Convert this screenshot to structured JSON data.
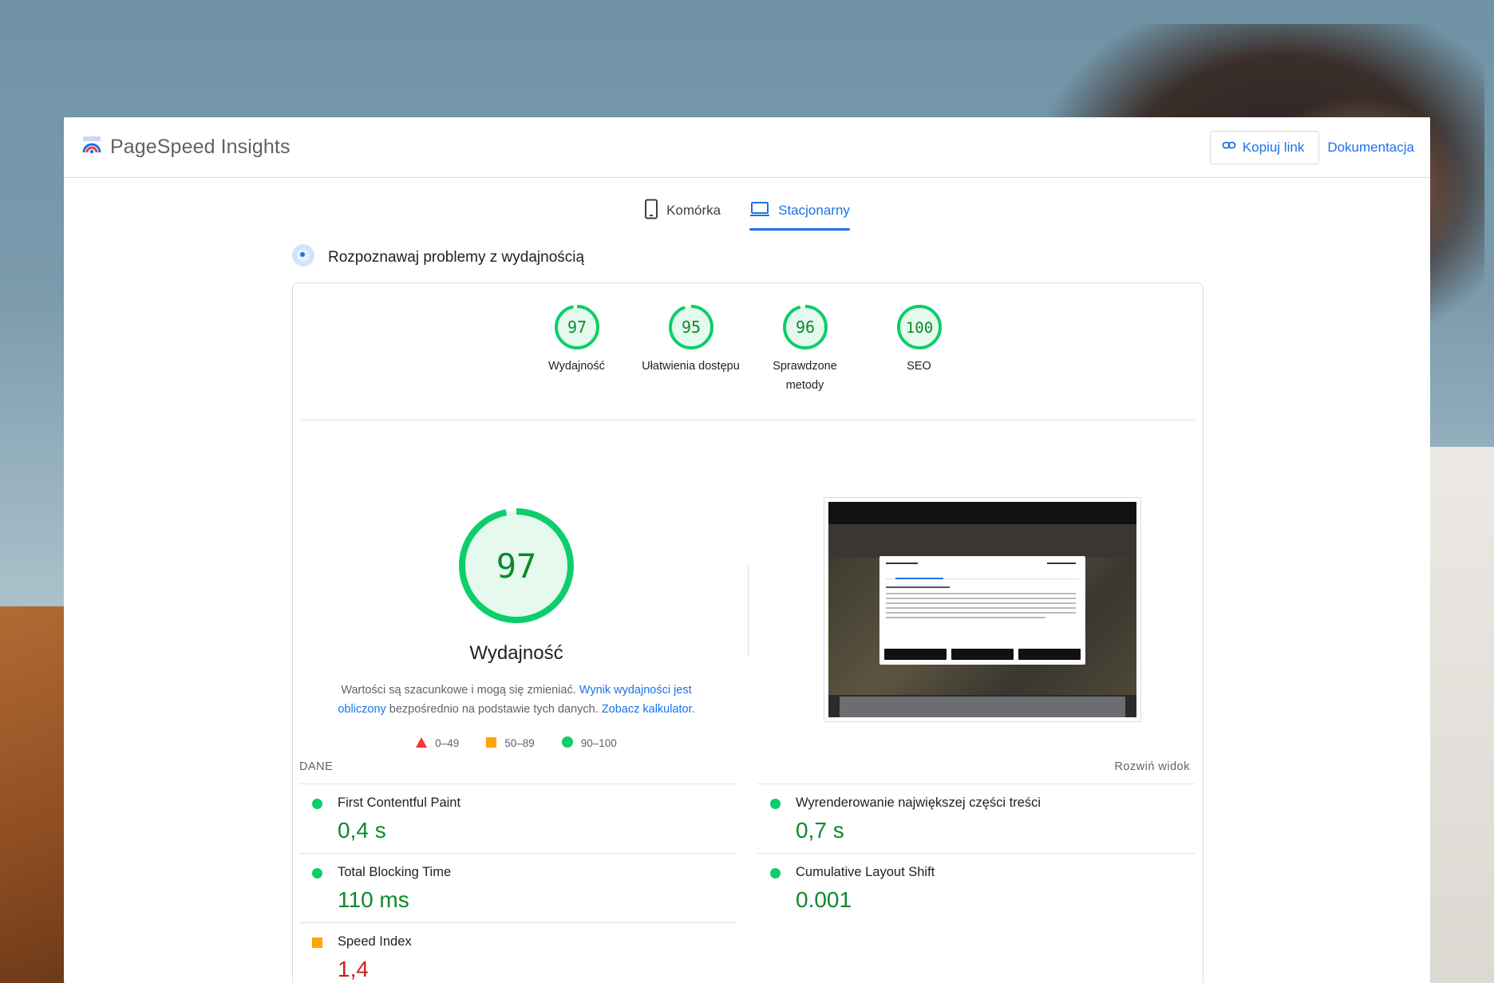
{
  "app": {
    "title": "PageSpeed Insights",
    "copy_link": "Kopiuj link",
    "docs": "Dokumentacja"
  },
  "tabs": [
    {
      "label": "Komórka",
      "active": false
    },
    {
      "label": "Stacjonarny",
      "active": true
    }
  ],
  "diagnose": {
    "label": "Rozpoznawaj problemy z wydajnością"
  },
  "categories": [
    {
      "score": "97",
      "label": "Wydajność",
      "value": 97
    },
    {
      "score": "95",
      "label": "Ułatwienia dostępu",
      "value": 95
    },
    {
      "score": "96",
      "label": "Sprawdzone metody",
      "value": 96
    },
    {
      "score": "100",
      "label": "SEO",
      "value": 100
    }
  ],
  "performance": {
    "score": "97",
    "value": 97,
    "title": "Wydajność",
    "desc_1": "Wartości są szacunkowe i mogą się zmieniać.",
    "desc_link_1": "Wynik wydajności jest obliczony",
    "desc_2": "bezpośrednio na podstawie tych danych.",
    "desc_link_2": "Zobacz kalkulator",
    "desc_3": "."
  },
  "legend": [
    {
      "range": "0–49",
      "color": "#f33"
    },
    {
      "range": "50–89",
      "color": "#ffa400"
    },
    {
      "range": "90–100",
      "color": "#0cce6b"
    }
  ],
  "metrics_header": {
    "label": "DANE",
    "expand": "Rozwiń widok"
  },
  "metrics": [
    {
      "name": "First Contentful Paint",
      "value": "0,4 s",
      "status": "good"
    },
    {
      "name": "Wyrenderowanie największej części treści",
      "value": "0,7 s",
      "status": "good"
    },
    {
      "name": "Total Blocking Time",
      "value": "110 ms",
      "status": "good"
    },
    {
      "name": "Cumulative Layout Shift",
      "value": "0.001",
      "status": "good"
    },
    {
      "name": "Speed Index",
      "value": "1,4",
      "status": "average"
    }
  ],
  "colors": {
    "accent": "#1a73e8",
    "good": "#0cce6b",
    "good_text": "#0c8a2c",
    "average": "#ffa400"
  }
}
